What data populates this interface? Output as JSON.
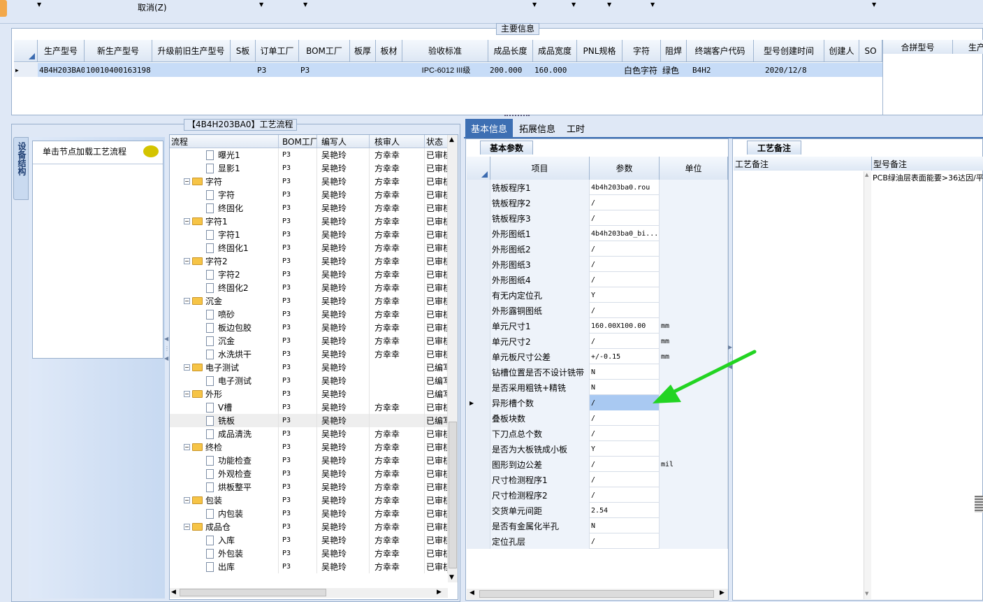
{
  "toolbar": {
    "cancel_label": "取消(Z)"
  },
  "main_info": {
    "title": "主要信息",
    "columns": [
      "生产型号",
      "新生产型号",
      "升级前旧生产型号",
      "S板",
      "订单工厂",
      "BOM工厂",
      "板厚",
      "板材",
      "验收标准",
      "成品长度",
      "成品宽度",
      "PNL规格",
      "字符",
      "阻焊",
      "终端客户代码",
      "型号创建时间",
      "创建人",
      "SO"
    ],
    "row": [
      "4B4H203BA0",
      "10010400163198",
      "",
      "",
      "P3",
      "P3",
      "",
      "",
      "IPC-6012 III级",
      "200.000",
      "160.000",
      "",
      "白色字符",
      "绿色",
      "B4H2",
      "2020/12/8",
      "",
      ""
    ],
    "right_columns": [
      "合拼型号",
      "生产"
    ]
  },
  "process": {
    "title": "【4B4H203BA0】工艺流程",
    "side_tab": "设备结构",
    "load_hint": "单击节点加载工艺流程",
    "columns": [
      "流程",
      "BOM工厂",
      "编写人",
      "核审人",
      "状态"
    ],
    "rows": [
      {
        "name": "曝光1",
        "type": "doc",
        "bom": "P3",
        "writer": "吴艳玲",
        "reviewer": "方幸幸",
        "status": "已审核"
      },
      {
        "name": "显影1",
        "type": "doc",
        "bom": "P3",
        "writer": "吴艳玲",
        "reviewer": "方幸幸",
        "status": "已审核"
      },
      {
        "name": "字符",
        "type": "folder",
        "bom": "P3",
        "writer": "吴艳玲",
        "reviewer": "方幸幸",
        "status": "已审核"
      },
      {
        "name": "字符",
        "type": "doc",
        "bom": "P3",
        "writer": "吴艳玲",
        "reviewer": "方幸幸",
        "status": "已审核"
      },
      {
        "name": "终固化",
        "type": "doc",
        "bom": "P3",
        "writer": "吴艳玲",
        "reviewer": "方幸幸",
        "status": "已审核"
      },
      {
        "name": "字符1",
        "type": "folder",
        "bom": "P3",
        "writer": "吴艳玲",
        "reviewer": "方幸幸",
        "status": "已审核"
      },
      {
        "name": "字符1",
        "type": "doc",
        "bom": "P3",
        "writer": "吴艳玲",
        "reviewer": "方幸幸",
        "status": "已审核"
      },
      {
        "name": "终固化1",
        "type": "doc",
        "bom": "P3",
        "writer": "吴艳玲",
        "reviewer": "方幸幸",
        "status": "已审核"
      },
      {
        "name": "字符2",
        "type": "folder",
        "bom": "P3",
        "writer": "吴艳玲",
        "reviewer": "方幸幸",
        "status": "已审核"
      },
      {
        "name": "字符2",
        "type": "doc",
        "bom": "P3",
        "writer": "吴艳玲",
        "reviewer": "方幸幸",
        "status": "已审核"
      },
      {
        "name": "终固化2",
        "type": "doc",
        "bom": "P3",
        "writer": "吴艳玲",
        "reviewer": "方幸幸",
        "status": "已审核"
      },
      {
        "name": "沉金",
        "type": "folder",
        "bom": "P3",
        "writer": "吴艳玲",
        "reviewer": "方幸幸",
        "status": "已审核"
      },
      {
        "name": "喷砂",
        "type": "doc",
        "bom": "P3",
        "writer": "吴艳玲",
        "reviewer": "方幸幸",
        "status": "已审核"
      },
      {
        "name": "板边包胶",
        "type": "doc",
        "bom": "P3",
        "writer": "吴艳玲",
        "reviewer": "方幸幸",
        "status": "已审核"
      },
      {
        "name": "沉金",
        "type": "doc",
        "bom": "P3",
        "writer": "吴艳玲",
        "reviewer": "方幸幸",
        "status": "已审核"
      },
      {
        "name": "水洗烘干",
        "type": "doc",
        "bom": "P3",
        "writer": "吴艳玲",
        "reviewer": "方幸幸",
        "status": "已审核"
      },
      {
        "name": "电子测试",
        "type": "folder",
        "bom": "P3",
        "writer": "吴艳玲",
        "reviewer": "",
        "status": "已编写"
      },
      {
        "name": "电子测试",
        "type": "doc",
        "bom": "P3",
        "writer": "吴艳玲",
        "reviewer": "",
        "status": "已编写"
      },
      {
        "name": "外形",
        "type": "folder",
        "bom": "P3",
        "writer": "吴艳玲",
        "reviewer": "",
        "status": "已编写"
      },
      {
        "name": "V槽",
        "type": "doc",
        "bom": "P3",
        "writer": "吴艳玲",
        "reviewer": "方幸幸",
        "status": "已审核"
      },
      {
        "name": "铣板",
        "type": "doc",
        "bom": "P3",
        "writer": "吴艳玲",
        "reviewer": "",
        "status": "已编写"
      },
      {
        "name": "成品清洗",
        "type": "doc",
        "bom": "P3",
        "writer": "吴艳玲",
        "reviewer": "方幸幸",
        "status": "已审核"
      },
      {
        "name": "终检",
        "type": "folder",
        "bom": "P3",
        "writer": "吴艳玲",
        "reviewer": "方幸幸",
        "status": "已审核"
      },
      {
        "name": "功能检查",
        "type": "doc",
        "bom": "P3",
        "writer": "吴艳玲",
        "reviewer": "方幸幸",
        "status": "已审核"
      },
      {
        "name": "外观检查",
        "type": "doc",
        "bom": "P3",
        "writer": "吴艳玲",
        "reviewer": "方幸幸",
        "status": "已审核"
      },
      {
        "name": "烘板整平",
        "type": "doc",
        "bom": "P3",
        "writer": "吴艳玲",
        "reviewer": "方幸幸",
        "status": "已审核"
      },
      {
        "name": "包装",
        "type": "folder",
        "bom": "P3",
        "writer": "吴艳玲",
        "reviewer": "方幸幸",
        "status": "已审核"
      },
      {
        "name": "内包装",
        "type": "doc",
        "bom": "P3",
        "writer": "吴艳玲",
        "reviewer": "方幸幸",
        "status": "已审核"
      },
      {
        "name": "成品仓",
        "type": "folder",
        "bom": "P3",
        "writer": "吴艳玲",
        "reviewer": "方幸幸",
        "status": "已审核"
      },
      {
        "name": "入库",
        "type": "doc",
        "bom": "P3",
        "writer": "吴艳玲",
        "reviewer": "方幸幸",
        "status": "已审核"
      },
      {
        "name": "外包装",
        "type": "doc",
        "bom": "P3",
        "writer": "吴艳玲",
        "reviewer": "方幸幸",
        "status": "已审核"
      },
      {
        "name": "出库",
        "type": "doc",
        "bom": "P3",
        "writer": "吴艳玲",
        "reviewer": "方幸幸",
        "status": "已审核"
      }
    ]
  },
  "tabs": [
    "基本信息",
    "拓展信息",
    "工时"
  ],
  "basic": {
    "subtab": "基本参数",
    "columns": [
      "项目",
      "参数",
      "单位"
    ],
    "rows": [
      {
        "item": "铣板程序1",
        "param": "4b4h203ba0.rou",
        "unit": ""
      },
      {
        "item": "铣板程序2",
        "param": "/",
        "unit": ""
      },
      {
        "item": "铣板程序3",
        "param": "/",
        "unit": ""
      },
      {
        "item": "外形图纸1",
        "param": "4b4h203ba0_bi...",
        "unit": ""
      },
      {
        "item": "外形图纸2",
        "param": "/",
        "unit": ""
      },
      {
        "item": "外形图纸3",
        "param": "/",
        "unit": ""
      },
      {
        "item": "外形图纸4",
        "param": "/",
        "unit": ""
      },
      {
        "item": "有无内定位孔",
        "param": "Y",
        "unit": ""
      },
      {
        "item": "外形露铜图纸",
        "param": "/",
        "unit": ""
      },
      {
        "item": "单元尺寸1",
        "param": "160.00X100.00",
        "unit": "mm"
      },
      {
        "item": "单元尺寸2",
        "param": "/",
        "unit": "mm"
      },
      {
        "item": "单元板尺寸公差",
        "param": "+/-0.15",
        "unit": "mm"
      },
      {
        "item": "钻槽位置是否不设计铣带",
        "param": "N",
        "unit": ""
      },
      {
        "item": "是否采用粗铣+精铣",
        "param": "N",
        "unit": ""
      },
      {
        "item": "异形槽个数",
        "param": "/",
        "unit": ""
      },
      {
        "item": "叠板块数",
        "param": "/",
        "unit": ""
      },
      {
        "item": "下刀点总个数",
        "param": "/",
        "unit": ""
      },
      {
        "item": "是否为大板铣成小板",
        "param": "Y",
        "unit": ""
      },
      {
        "item": "图形到边公差",
        "param": "/",
        "unit": "mil"
      },
      {
        "item": "尺寸检测程序1",
        "param": "/",
        "unit": ""
      },
      {
        "item": "尺寸检测程序2",
        "param": "/",
        "unit": ""
      },
      {
        "item": "交货单元间距",
        "param": "2.54",
        "unit": ""
      },
      {
        "item": "是否有金属化半孔",
        "param": "N",
        "unit": ""
      },
      {
        "item": "定位孔层",
        "param": "/",
        "unit": ""
      }
    ]
  },
  "remarks": {
    "subtab": "工艺备注",
    "col1": "工艺备注",
    "col2": "型号备注",
    "model_note": "PCB绿油层表面能要>36达因/平"
  },
  "colors": {
    "selected": "#c7dcf7",
    "accent": "#3d6fb3",
    "arrow": "#22d422"
  }
}
